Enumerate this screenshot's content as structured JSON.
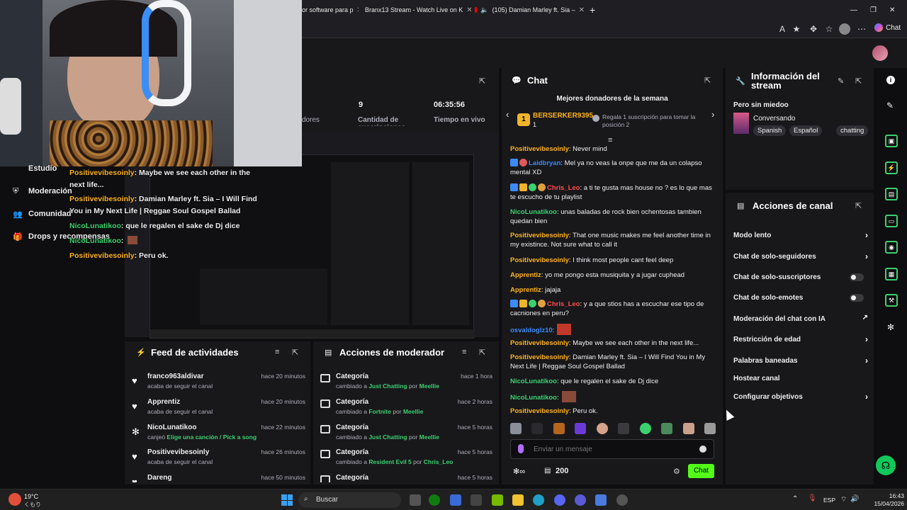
{
  "browser": {
    "tabs": [
      {
        "title": "or software para p"
      },
      {
        "title": "Branx13 Stream - Watch Live on K"
      },
      {
        "title": "(105) Damian Marley ft. Sia –"
      }
    ],
    "new_tab": "+",
    "chat_button": "Chat"
  },
  "stats": {
    "followers_label": "dores",
    "viewers_value": "9",
    "viewers_label": "Cantidad de suscripciones",
    "time_value": "06:35:56",
    "time_label": "Tiempo en vivo"
  },
  "left_nav": {
    "items": [
      {
        "label": "Estudio"
      },
      {
        "label": "Moderación"
      },
      {
        "label": "Comunidad"
      },
      {
        "label": "Drops y recompensas"
      }
    ]
  },
  "overlay_chat": [
    {
      "user": "Positivevibesoinly",
      "text": ": Maybe we see each other in the next life..."
    },
    {
      "user": "Positivevibesoinly",
      "text": ": Damian Marley ft. Sia – I Will Find You in My Next Life | Reggae Soul Gospel Ballad"
    },
    {
      "user": "NicoLunatikoo",
      "text": ": que le regalen el sake de Dj dice"
    },
    {
      "user": "NicoLunatikoo",
      "text": ":"
    },
    {
      "user": "Positivevibesoinly",
      "text": ": Peru ok."
    }
  ],
  "chat": {
    "title": "Chat",
    "donors_title": "Mejores donadores de la semana",
    "top_donor": "BERSERKER9395",
    "top_donor_count": "1",
    "donor_note": "Regala 1 suscripción para tomar la posición 2",
    "messages": [
      {
        "user": "Positivevibesoinly",
        "color": "o",
        "text": ": Never mind"
      },
      {
        "user": "Laidbryan",
        "color": "b",
        "text": ": Mel ya no veas la onpe que me da un colapso mental XD"
      },
      {
        "user": "Chris_Leo",
        "color": "r",
        "text": ": a ti te gusta mas house no ? es lo que mas te escucho de tu playlist"
      },
      {
        "user": "NicoLunatikoo",
        "color": "g",
        "text": ": unas baladas de rock bien ochentosas tambien quedan bien"
      },
      {
        "user": "Positivevibesoinly",
        "color": "o",
        "text": ": That one music makes me feel another time in my existince. Not sure what to call it"
      },
      {
        "user": "Positivevibesoinly",
        "color": "o",
        "text": ": I think most people cant feel deep"
      },
      {
        "user": "Apprentiz",
        "color": "o",
        "text": ": yo me pongo esta musiquita y a jugar cuphead"
      },
      {
        "user": "Apprentiz",
        "color": "o",
        "text": ": jajaja"
      },
      {
        "user": "Chris_Leo",
        "color": "r",
        "text": ": y a que stios has a escuchar ese tipo de cacniones en peru?"
      },
      {
        "user": "osvaldoglz10",
        "color": "b",
        "text": ":"
      },
      {
        "user": "Positivevibesoinly",
        "color": "o",
        "text": ": Maybe we see each other in the next life..."
      },
      {
        "user": "Positivevibesoinly",
        "color": "o",
        "text": ": Damian Marley ft. Sia – I Will Find You in My Next Life | Reggae Soul Gospel Ballad"
      },
      {
        "user": "NicoLunatikoo",
        "color": "g",
        "text": ": que le regalen el sake de Dj dice"
      },
      {
        "user": "NicoLunatikoo",
        "color": "g",
        "text": ":"
      },
      {
        "user": "Positivevibesoinly",
        "color": "o",
        "text": ": Peru ok."
      }
    ],
    "input_placeholder": "Enviar un mensaje",
    "points": "200",
    "send_label": "Chat"
  },
  "stream_info": {
    "title": "Información del stream",
    "stream_title": "Pero sin miedoo",
    "category": "Conversando",
    "tags": [
      "Spanish",
      "Español",
      "chatting"
    ]
  },
  "channel_actions": {
    "title": "Acciones de canal",
    "items": [
      {
        "label": "Modo lento",
        "kind": "arrow"
      },
      {
        "label": "Chat de solo-seguidores",
        "kind": "arrow"
      },
      {
        "label": "Chat de solo-suscriptores",
        "kind": "toggle"
      },
      {
        "label": "Chat de solo-emotes",
        "kind": "toggle"
      },
      {
        "label": "Moderación del chat con IA",
        "kind": "link"
      },
      {
        "label": "Restricción de edad",
        "kind": "arrow"
      },
      {
        "label": "Palabras baneadas",
        "kind": "arrow"
      },
      {
        "label": "Hostear canal",
        "kind": "none"
      },
      {
        "label": "Configurar objetivos",
        "kind": "arrow"
      }
    ]
  },
  "activity_feed": {
    "title": "Feed de actividades",
    "items": [
      {
        "name": "franco963aldivar",
        "sub": "acaba de seguir el canal",
        "time": "hace 20 minutos",
        "icon": "heart-icon"
      },
      {
        "name": "Apprentiz",
        "sub": "acaba de seguir el canal",
        "time": "hace 20 minutos",
        "icon": "heart-icon"
      },
      {
        "name": "NicoLunatikoo",
        "sub_prefix": "canjeó ",
        "sub_highlight": "Elige una canción / Pick a song",
        "time": "hace 22 minutos",
        "icon": "points-icon"
      },
      {
        "name": "Positivevibesoinly",
        "sub": "acaba de seguir el canal",
        "time": "hace 26 minutos",
        "icon": "heart-icon"
      },
      {
        "name": "Dareng",
        "sub": "",
        "time": "hace 50 minutos",
        "icon": "heart-icon"
      }
    ]
  },
  "mod_actions": {
    "title": "Acciones de moderador",
    "items": [
      {
        "name": "Categoría",
        "pre": "cambiado a ",
        "cat": "Just Chatting",
        "por": " por ",
        "by": "Meellie",
        "time": "hace 1 hora"
      },
      {
        "name": "Categoría",
        "pre": "cambiado a ",
        "cat": "Fortnite",
        "por": " por ",
        "by": "Meellie",
        "time": "hace 2 horas"
      },
      {
        "name": "Categoría",
        "pre": "cambiado a ",
        "cat": "Just Chatting",
        "por": " por ",
        "by": "Meellie",
        "time": "hace 5 horas"
      },
      {
        "name": "Categoría",
        "pre": "cambiado a ",
        "cat": "Resident Evil 5",
        "por": " por ",
        "by": "Chris_Leo",
        "time": "hace 5 horas"
      },
      {
        "name": "Categoría",
        "pre": "",
        "cat": "",
        "por": "",
        "by": "",
        "time": "hace 5 horas"
      }
    ]
  },
  "taskbar": {
    "weather_temp": "19°C",
    "weather_desc": "くもり",
    "search_label": "Buscar",
    "lang": "ESP",
    "time": "16:43",
    "date": "15/04/2026"
  },
  "colors": {
    "accent": "#53fc18",
    "bg": "#0e0e10",
    "panel": "#18181b"
  }
}
